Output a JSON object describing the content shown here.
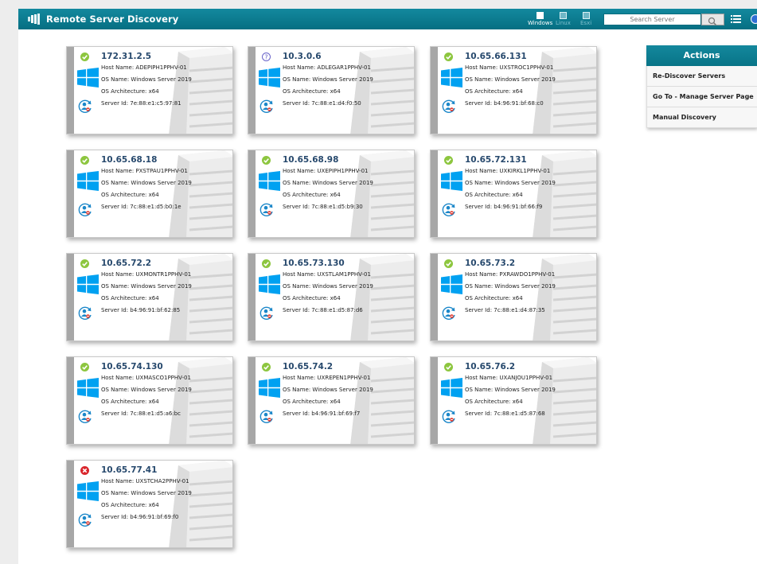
{
  "app": {
    "title": "Remote Server Discovery"
  },
  "filters": [
    {
      "label": "Windows",
      "active": true
    },
    {
      "label": "Linux",
      "active": false
    },
    {
      "label": "Esxi",
      "active": false
    }
  ],
  "search": {
    "placeholder": "Search Server"
  },
  "labels": {
    "host": "Host Name: ",
    "os": "OS Name: ",
    "arch": "OS Architecture: ",
    "id": "Server Id: "
  },
  "servers": [
    {
      "ip": "172.31.2.5",
      "host": "ADEPIPH1PPHV-01",
      "os": "Windows Server 2019",
      "arch": "x64",
      "id": "7e:88:e1:c5:97:81",
      "status": "ok"
    },
    {
      "ip": "10.3.0.6",
      "host": "ADLEGAR1PPHV-01",
      "os": "Windows Server 2019",
      "arch": "x64",
      "id": "7c:88:e1:d4:f0:50",
      "status": "unknown"
    },
    {
      "ip": "10.65.66.131",
      "host": "UXSTROC1PPHV-01",
      "os": "Windows Server 2019",
      "arch": "x64",
      "id": "b4:96:91:bf:68:c0",
      "status": "ok"
    },
    {
      "ip": "10.65.68.18",
      "host": "PXSTPAU1PPHV-01",
      "os": "Windows Server 2019",
      "arch": "x64",
      "id": "7c:88:e1:d5:b0:1e",
      "status": "ok"
    },
    {
      "ip": "10.65.68.98",
      "host": "UXEPIPH1PPHV-01",
      "os": "Windows Server 2019",
      "arch": "x64",
      "id": "7c:88:e1:d5:b9:30",
      "status": "ok"
    },
    {
      "ip": "10.65.72.131",
      "host": "UXKIRKL1PPHV-01",
      "os": "Windows Server 2019",
      "arch": "x64",
      "id": "b4:96:91:bf:66:f9",
      "status": "ok"
    },
    {
      "ip": "10.65.72.2",
      "host": "UXMONTR1PPHV-01",
      "os": "Windows Server 2019",
      "arch": "x64",
      "id": "b4:96:91:bf:62:85",
      "status": "ok"
    },
    {
      "ip": "10.65.73.130",
      "host": "UXSTLAM1PPHV-01",
      "os": "Windows Server 2019",
      "arch": "x64",
      "id": "7c:88:e1:d5:87:d6",
      "status": "ok"
    },
    {
      "ip": "10.65.73.2",
      "host": "PXRAWDO1PPHV-01",
      "os": "Windows Server 2019",
      "arch": "x64",
      "id": "7c:88:e1:d4:87:35",
      "status": "ok"
    },
    {
      "ip": "10.65.74.130",
      "host": "UXMASCO1PPHV-01",
      "os": "Windows Server 2019",
      "arch": "x64",
      "id": "7c:88:e1:d5:a6:bc",
      "status": "ok"
    },
    {
      "ip": "10.65.74.2",
      "host": "UXREPEN1PPHV-01",
      "os": "Windows Server 2019",
      "arch": "x64",
      "id": "b4:96:91:bf:69:f7",
      "status": "ok"
    },
    {
      "ip": "10.65.76.2",
      "host": "UXANJOU1PPHV-01",
      "os": "Windows Server 2019",
      "arch": "x64",
      "id": "7c:88:e1:d5:87:68",
      "status": "ok"
    },
    {
      "ip": "10.65.77.41",
      "host": "UXSTCHA2PPHV-01",
      "os": "Windows Server 2019",
      "arch": "x64",
      "id": "b4:96:91:bf:69:f0",
      "status": "error"
    }
  ],
  "actions": {
    "title": "Actions",
    "items": [
      "Re-Discover Servers",
      "Go To - Manage Server Page",
      "Manual Discovery"
    ]
  },
  "colors": {
    "brand": "#0c7f93",
    "ok": "#8dc63f",
    "error": "#d9262c",
    "unknown": "#6a64c9",
    "windows": "#00a1f1"
  }
}
